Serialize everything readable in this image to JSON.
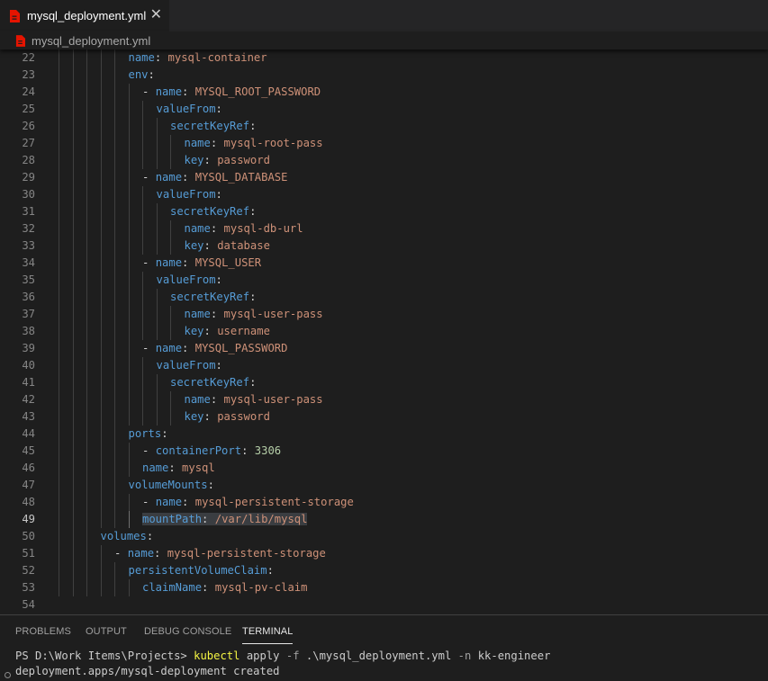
{
  "tab": {
    "filename": "mysql_deployment.yml",
    "close": "✕",
    "icon": "yaml-file-icon",
    "icon_color": "#e51400"
  },
  "breadcrumb": {
    "filename": "mysql_deployment.yml"
  },
  "editor": {
    "active_line": "49",
    "lines": [
      {
        "num": "22",
        "guides": 5,
        "tokens": [
          {
            "t": "name",
            "c": "k"
          },
          {
            "t": ": ",
            "c": "p"
          },
          {
            "t": "mysql-container",
            "c": "s"
          }
        ]
      },
      {
        "num": "23",
        "guides": 5,
        "tokens": [
          {
            "t": "env",
            "c": "k"
          },
          {
            "t": ":",
            "c": "p"
          }
        ]
      },
      {
        "num": "24",
        "guides": 6,
        "tokens": [
          {
            "t": "- ",
            "c": "p"
          },
          {
            "t": "name",
            "c": "k"
          },
          {
            "t": ": ",
            "c": "p"
          },
          {
            "t": "MYSQL_ROOT_PASSWORD",
            "c": "s"
          }
        ]
      },
      {
        "num": "25",
        "guides": 7,
        "tokens": [
          {
            "t": "valueFrom",
            "c": "k"
          },
          {
            "t": ":",
            "c": "p"
          }
        ]
      },
      {
        "num": "26",
        "guides": 8,
        "tokens": [
          {
            "t": "secretKeyRef",
            "c": "k"
          },
          {
            "t": ":",
            "c": "p"
          }
        ]
      },
      {
        "num": "27",
        "guides": 9,
        "tokens": [
          {
            "t": "name",
            "c": "k"
          },
          {
            "t": ": ",
            "c": "p"
          },
          {
            "t": "mysql-root-pass",
            "c": "s"
          }
        ]
      },
      {
        "num": "28",
        "guides": 9,
        "tokens": [
          {
            "t": "key",
            "c": "k"
          },
          {
            "t": ": ",
            "c": "p"
          },
          {
            "t": "password",
            "c": "s"
          }
        ]
      },
      {
        "num": "29",
        "guides": 6,
        "tokens": [
          {
            "t": "- ",
            "c": "p"
          },
          {
            "t": "name",
            "c": "k"
          },
          {
            "t": ": ",
            "c": "p"
          },
          {
            "t": "MYSQL_DATABASE",
            "c": "s"
          }
        ]
      },
      {
        "num": "30",
        "guides": 7,
        "tokens": [
          {
            "t": "valueFrom",
            "c": "k"
          },
          {
            "t": ":",
            "c": "p"
          }
        ]
      },
      {
        "num": "31",
        "guides": 8,
        "tokens": [
          {
            "t": "secretKeyRef",
            "c": "k"
          },
          {
            "t": ":",
            "c": "p"
          }
        ]
      },
      {
        "num": "32",
        "guides": 9,
        "tokens": [
          {
            "t": "name",
            "c": "k"
          },
          {
            "t": ": ",
            "c": "p"
          },
          {
            "t": "mysql-db-url",
            "c": "s"
          }
        ]
      },
      {
        "num": "33",
        "guides": 9,
        "tokens": [
          {
            "t": "key",
            "c": "k"
          },
          {
            "t": ": ",
            "c": "p"
          },
          {
            "t": "database",
            "c": "s"
          }
        ]
      },
      {
        "num": "34",
        "guides": 6,
        "tokens": [
          {
            "t": "- ",
            "c": "p"
          },
          {
            "t": "name",
            "c": "k"
          },
          {
            "t": ": ",
            "c": "p"
          },
          {
            "t": "MYSQL_USER",
            "c": "s"
          }
        ]
      },
      {
        "num": "35",
        "guides": 7,
        "tokens": [
          {
            "t": "valueFrom",
            "c": "k"
          },
          {
            "t": ":",
            "c": "p"
          }
        ]
      },
      {
        "num": "36",
        "guides": 8,
        "tokens": [
          {
            "t": "secretKeyRef",
            "c": "k"
          },
          {
            "t": ":",
            "c": "p"
          }
        ]
      },
      {
        "num": "37",
        "guides": 9,
        "tokens": [
          {
            "t": "name",
            "c": "k"
          },
          {
            "t": ": ",
            "c": "p"
          },
          {
            "t": "mysql-user-pass",
            "c": "s"
          }
        ]
      },
      {
        "num": "38",
        "guides": 9,
        "tokens": [
          {
            "t": "key",
            "c": "k"
          },
          {
            "t": ": ",
            "c": "p"
          },
          {
            "t": "username",
            "c": "s"
          }
        ]
      },
      {
        "num": "39",
        "guides": 6,
        "tokens": [
          {
            "t": "- ",
            "c": "p"
          },
          {
            "t": "name",
            "c": "k"
          },
          {
            "t": ": ",
            "c": "p"
          },
          {
            "t": "MYSQL_PASSWORD",
            "c": "s"
          }
        ]
      },
      {
        "num": "40",
        "guides": 7,
        "tokens": [
          {
            "t": "valueFrom",
            "c": "k"
          },
          {
            "t": ":",
            "c": "p"
          }
        ]
      },
      {
        "num": "41",
        "guides": 8,
        "tokens": [
          {
            "t": "secretKeyRef",
            "c": "k"
          },
          {
            "t": ":",
            "c": "p"
          }
        ]
      },
      {
        "num": "42",
        "guides": 9,
        "tokens": [
          {
            "t": "name",
            "c": "k"
          },
          {
            "t": ": ",
            "c": "p"
          },
          {
            "t": "mysql-user-pass",
            "c": "s"
          }
        ]
      },
      {
        "num": "43",
        "guides": 9,
        "tokens": [
          {
            "t": "key",
            "c": "k"
          },
          {
            "t": ": ",
            "c": "p"
          },
          {
            "t": "password",
            "c": "s"
          }
        ]
      },
      {
        "num": "44",
        "guides": 5,
        "tokens": [
          {
            "t": "ports",
            "c": "k"
          },
          {
            "t": ":",
            "c": "p"
          }
        ]
      },
      {
        "num": "45",
        "guides": 6,
        "tokens": [
          {
            "t": "- ",
            "c": "p"
          },
          {
            "t": "containerPort",
            "c": "k"
          },
          {
            "t": ": ",
            "c": "p"
          },
          {
            "t": "3306",
            "c": "n"
          }
        ]
      },
      {
        "num": "46",
        "guides": 6,
        "tokens": [
          {
            "t": "name",
            "c": "k"
          },
          {
            "t": ": ",
            "c": "p"
          },
          {
            "t": "mysql",
            "c": "s"
          }
        ]
      },
      {
        "num": "47",
        "guides": 5,
        "tokens": [
          {
            "t": "volumeMounts",
            "c": "k"
          },
          {
            "t": ":",
            "c": "p"
          }
        ]
      },
      {
        "num": "48",
        "guides": 6,
        "tokens": [
          {
            "t": "- ",
            "c": "p"
          },
          {
            "t": "name",
            "c": "k"
          },
          {
            "t": ": ",
            "c": "p"
          },
          {
            "t": "mysql-persistent-storage",
            "c": "s"
          }
        ]
      },
      {
        "num": "49",
        "guides": 6,
        "tokens": [
          {
            "t": "mountPath",
            "c": "k",
            "hl": true
          },
          {
            "t": ": ",
            "c": "p",
            "hl": true
          },
          {
            "t": "/var/lib/mysql",
            "c": "s",
            "hl": true
          }
        ]
      },
      {
        "num": "50",
        "guides": 3,
        "tokens": [
          {
            "t": "volumes",
            "c": "k"
          },
          {
            "t": ":",
            "c": "p"
          }
        ]
      },
      {
        "num": "51",
        "guides": 4,
        "tokens": [
          {
            "t": "- ",
            "c": "p"
          },
          {
            "t": "name",
            "c": "k"
          },
          {
            "t": ": ",
            "c": "p"
          },
          {
            "t": "mysql-persistent-storage",
            "c": "s"
          }
        ]
      },
      {
        "num": "52",
        "guides": 5,
        "tokens": [
          {
            "t": "persistentVolumeClaim",
            "c": "k"
          },
          {
            "t": ":",
            "c": "p"
          }
        ]
      },
      {
        "num": "53",
        "guides": 6,
        "tokens": [
          {
            "t": "claimName",
            "c": "k"
          },
          {
            "t": ": ",
            "c": "p"
          },
          {
            "t": "mysql-pv-claim",
            "c": "s"
          }
        ]
      },
      {
        "num": "54",
        "guides": 0,
        "tokens": []
      }
    ]
  },
  "panel": {
    "tabs": [
      {
        "label": "PROBLEMS",
        "active": false
      },
      {
        "label": "OUTPUT",
        "active": false
      },
      {
        "label": "DEBUG CONSOLE",
        "active": false
      },
      {
        "label": "TERMINAL",
        "active": true
      }
    ],
    "terminal": {
      "prompt": "PS D:\\Work Items\\Projects> ",
      "command": "kubectl",
      "args_a": " apply ",
      "flag_f": "-f",
      "args_b": " .\\mysql_deployment.yml ",
      "flag_n": "-n",
      "args_c": " kk-engineer",
      "output": "deployment.apps/mysql-deployment created"
    }
  },
  "colors": {
    "keyword": "#569cd6",
    "string": "#ce9178",
    "number": "#b5cea8",
    "command": "#f5f543"
  }
}
